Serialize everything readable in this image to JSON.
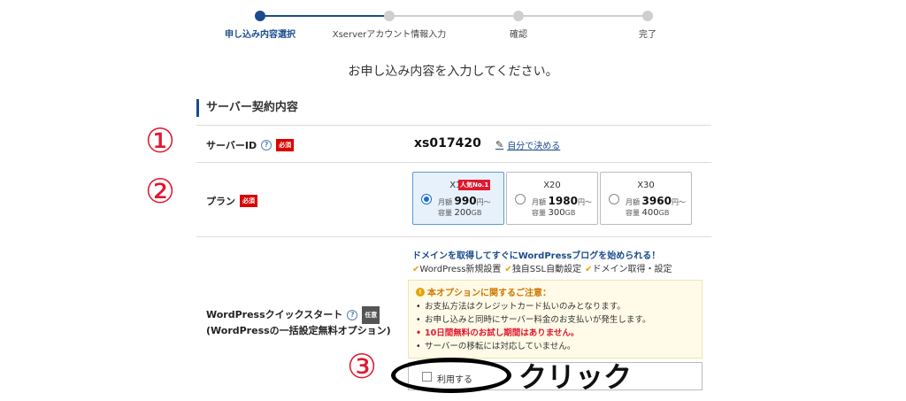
{
  "stepper": {
    "steps": [
      {
        "label": "申し込み内容選択",
        "active": true
      },
      {
        "label": "Xserverアカウント情報入力",
        "active": false
      },
      {
        "label": "確認",
        "active": false
      },
      {
        "label": "完了",
        "active": false
      }
    ]
  },
  "intro": "お申し込み内容を入力してください。",
  "section_title": "サーバー契約内容",
  "annotations": {
    "a1": "①",
    "a2": "②",
    "a3": "③",
    "click": "クリック"
  },
  "server_id": {
    "label": "サーバーID",
    "help": "?",
    "required": "必須",
    "value": "xs017420",
    "link": "自分で決める"
  },
  "plan": {
    "label": "プラン",
    "required": "必須",
    "options": [
      {
        "name": "X10",
        "popular": "人気No.1",
        "monthly_label": "月額",
        "price": "990",
        "price_unit": "円〜",
        "storage_label": "容量",
        "storage": "200",
        "storage_unit": "GB",
        "selected": true
      },
      {
        "name": "X20",
        "popular": "",
        "monthly_label": "月額",
        "price": "1980",
        "price_unit": "円〜",
        "storage_label": "容量",
        "storage": "300",
        "storage_unit": "GB",
        "selected": false
      },
      {
        "name": "X30",
        "popular": "",
        "monthly_label": "月額",
        "price": "3960",
        "price_unit": "円〜",
        "storage_label": "容量",
        "storage": "400",
        "storage_unit": "GB",
        "selected": false
      }
    ]
  },
  "wp": {
    "label_line1": "WordPressクイックスタート",
    "help": "?",
    "optional": "任意",
    "label_line2": "(WordPressの一括設定無料オプション)",
    "headline": "ドメインを取得してすぐにWordPressブログを始められる！",
    "features": [
      "WordPress新規設置",
      "独自SSL自動設定",
      "ドメイン取得・設定"
    ],
    "notice_title": "本オプションに関するご注意：",
    "notice_items": [
      "お支払方法はクレジットカード払いのみとなります。",
      "お申し込みと同時にサーバー料金のお支払いが発生します。",
      "10日間無料のお試し期間はありません。",
      "サーバーの移転には対応していません。"
    ],
    "use_label": "利用する"
  },
  "colors": {
    "accent": "#1a4b8c",
    "required": "#e0182d",
    "selected_bg": "#e7f1fb",
    "annotation": "#e0182d"
  }
}
